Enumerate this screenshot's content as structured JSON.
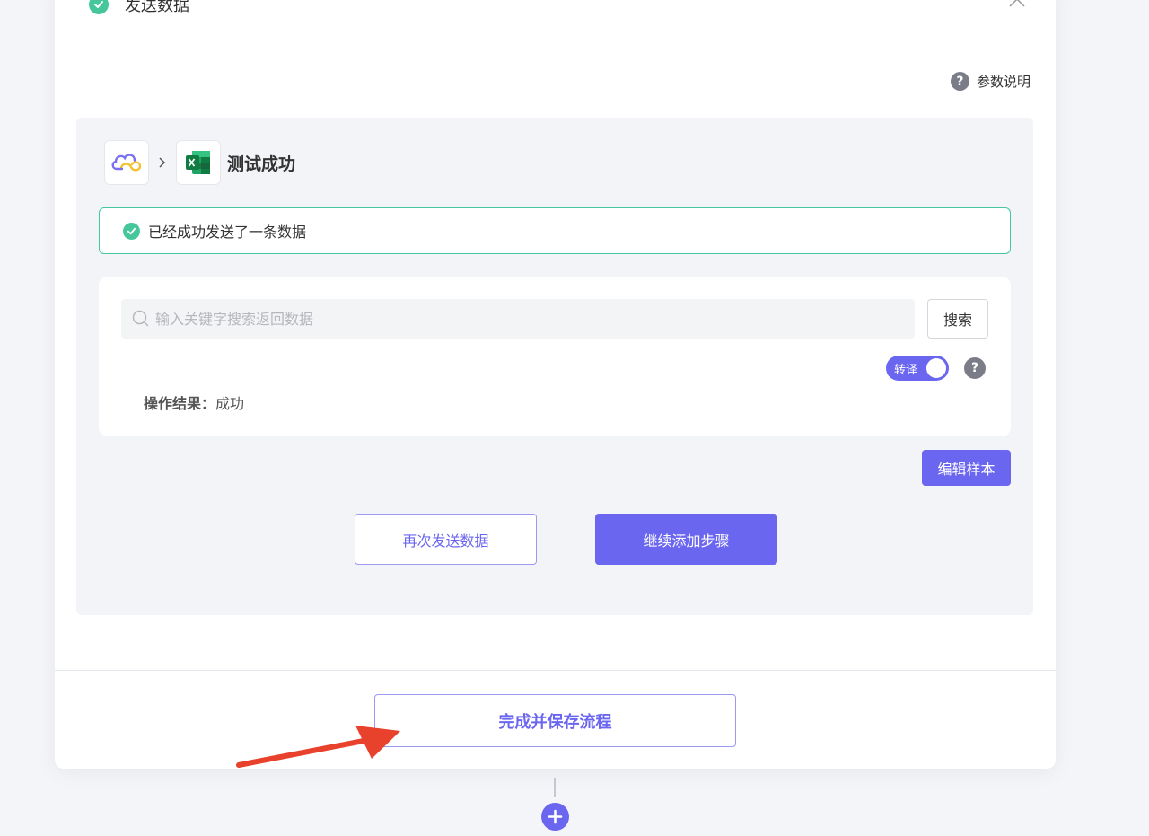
{
  "step": {
    "title": "发送数据"
  },
  "param_help": {
    "label": "参数说明"
  },
  "app_chain": {
    "status": "测试成功"
  },
  "banner": {
    "message": "已经成功发送了一条数据"
  },
  "search": {
    "placeholder": "输入关键字搜索返回数据",
    "value": "",
    "button_label": "搜索"
  },
  "toggle": {
    "label": "转译",
    "on": true
  },
  "result": {
    "key": "操作结果：",
    "value": "成功"
  },
  "buttons": {
    "edit_sample": "编辑样本",
    "resend": "再次发送数据",
    "continue": "继续添加步骤",
    "finish": "完成并保存流程"
  },
  "colors": {
    "accent": "#6b66f0",
    "success": "#45c79b",
    "annotation_arrow": "#e8412c"
  }
}
